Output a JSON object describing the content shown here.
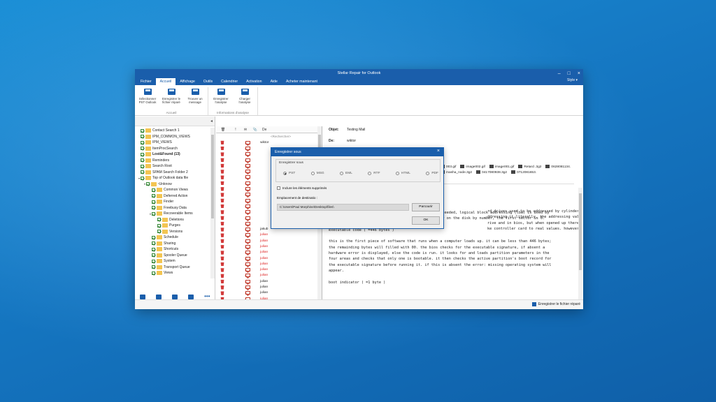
{
  "window": {
    "title": "Stellar Repair for Outlook",
    "style_label": "Style ▾"
  },
  "tabs": [
    "Fichier",
    "Accueil",
    "Affichage",
    "Outils",
    "Calendrier",
    "Activation",
    "Aide",
    "Acheter maintenant"
  ],
  "ribbon": {
    "groups": [
      {
        "label": "Accueil",
        "buttons": [
          {
            "label": "Sélectionner PST Outlook",
            "icon": "folder-icon"
          },
          {
            "label": "Enregistrer le fichier réparé",
            "icon": "save-icon"
          },
          {
            "label": "Trouver un message",
            "icon": "find-message-icon"
          }
        ]
      },
      {
        "label": "Informations d'analyse",
        "buttons": [
          {
            "label": "Enregistrer l'analyse",
            "icon": "save-analysis-icon"
          },
          {
            "label": "Charger l'analyse",
            "icon": "load-analysis-icon"
          }
        ]
      }
    ]
  },
  "tree": [
    {
      "label": "Contact Search 1",
      "indent": 1,
      "bold": false,
      "twisty": ""
    },
    {
      "label": "IPM_COMMON_VIEWS",
      "indent": 1,
      "bold": false,
      "twisty": ""
    },
    {
      "label": "IPM_VIEWS",
      "indent": 1,
      "bold": false,
      "twisty": ""
    },
    {
      "label": "ItemProcSearch",
      "indent": 1,
      "bold": false,
      "twisty": ""
    },
    {
      "label": "Lost&Found (13)",
      "indent": 1,
      "bold": true,
      "twisty": ""
    },
    {
      "label": "Reminders",
      "indent": 1,
      "bold": false,
      "twisty": ""
    },
    {
      "label": "Search Root",
      "indent": 1,
      "bold": false,
      "twisty": ""
    },
    {
      "label": "SPAM Search Folder 2",
      "indent": 1,
      "bold": false,
      "twisty": ""
    },
    {
      "label": "Top of Outlook data file",
      "indent": 1,
      "bold": false,
      "twisty": "▾"
    },
    {
      "label": "¹Unknow",
      "indent": 2,
      "bold": false,
      "twisty": "▾"
    },
    {
      "label": "Common Views",
      "indent": 3,
      "bold": false,
      "twisty": ""
    },
    {
      "label": "Deferred Action",
      "indent": 3,
      "bold": false,
      "twisty": ""
    },
    {
      "label": "Finder",
      "indent": 3,
      "bold": false,
      "twisty": ""
    },
    {
      "label": "Freebusy Data",
      "indent": 3,
      "bold": false,
      "twisty": ""
    },
    {
      "label": "Recoverable Items",
      "indent": 3,
      "bold": false,
      "twisty": "▾"
    },
    {
      "label": "Deletions",
      "indent": 4,
      "bold": false,
      "twisty": ""
    },
    {
      "label": "Purges",
      "indent": 4,
      "bold": false,
      "twisty": ""
    },
    {
      "label": "Versions",
      "indent": 4,
      "bold": false,
      "twisty": ""
    },
    {
      "label": "Schedule",
      "indent": 3,
      "bold": false,
      "twisty": ""
    },
    {
      "label": "Sharing",
      "indent": 3,
      "bold": false,
      "twisty": ""
    },
    {
      "label": "Shortcuts",
      "indent": 3,
      "bold": false,
      "twisty": ""
    },
    {
      "label": "Spooler Queue",
      "indent": 3,
      "bold": false,
      "twisty": ""
    },
    {
      "label": "System",
      "indent": 3,
      "bold": false,
      "twisty": ""
    },
    {
      "label": "Transport Queue",
      "indent": 3,
      "bold": false,
      "twisty": ""
    },
    {
      "label": "Views",
      "indent": 3,
      "bold": false,
      "twisty": ""
    }
  ],
  "nav": [
    "mail-icon",
    "calendar-icon",
    "contacts-icon",
    "tasks-icon",
    "more-icon"
  ],
  "message_list": {
    "header_de": "De",
    "search_placeholder": "<Rechercher>",
    "rows": [
      {
        "from": "wiktor",
        "dark": true
      },
      {
        "from": "",
        "dark": false
      },
      {
        "from": "",
        "dark": false
      },
      {
        "from": "",
        "dark": false
      },
      {
        "from": "",
        "dark": false
      },
      {
        "from": "",
        "dark": false
      },
      {
        "from": "",
        "dark": false
      },
      {
        "from": "",
        "dark": false
      },
      {
        "from": "",
        "dark": false
      },
      {
        "from": "",
        "dark": false
      },
      {
        "from": "",
        "dark": false
      },
      {
        "from": "",
        "dark": false
      },
      {
        "from": "",
        "dark": false
      },
      {
        "from": "",
        "dark": false
      },
      {
        "from": "",
        "dark": false
      },
      {
        "from": "jakub",
        "dark": true
      },
      {
        "from": "julian",
        "dark": false
      },
      {
        "from": "julian",
        "dark": false
      },
      {
        "from": "julian",
        "dark": false
      },
      {
        "from": "julian",
        "dark": false
      },
      {
        "from": "julian",
        "dark": false
      },
      {
        "from": "julian",
        "dark": false
      },
      {
        "from": "julian",
        "dark": false
      },
      {
        "from": "julian",
        "dark": false
      },
      {
        "from": "julian",
        "dark": true
      },
      {
        "from": "julian",
        "dark": true
      },
      {
        "from": "julian",
        "dark": true
      },
      {
        "from": "julian",
        "dark": false
      }
    ]
  },
  "reading_pane": {
    "subject_label": "Objet:",
    "subject": "Testing Mail",
    "from_label": "De:",
    "from": "wiktor",
    "attachments": [
      "003.gif",
      "image002.gif",
      "image001.gif",
      "Retard .3g2",
      "0628081134.",
      "masha_node.3g2",
      "0417080938.3g2",
      "0712081653."
    ],
    "body_top": "rd drives used to be addressed by cylinder, head and\nddressing it literally, the addressing values became\nrive and in bios, but when opened up there were only 6\nke controller card to real values. however virtual chs",
    "body": "addressing is also limited, when these values are exceeded, logical block addressing (lba) is used by\npartitions. lba is achieved by addressing each sector on the disk by number, the first sector is 0.\n\nexecutable code ( =446 bytes )\n\nthis is the first piece of software that runs when a computer loads up. it can be less than 446 bytes;\nthe remainding bytes will filled with 00. the bios checks for the executable signature, if absent a\nhardware error is displayed, else the code is run. it looks for and loads partition parameters in the\nfour areas and checks that only one is bootable. it then checks the active partition's boot record for\nthe executable signature before running it. if this is absent the error: missing operating system will\nappear.\n\nboot indicator ( =1 byte )"
  },
  "status": {
    "save_label": "Enregistrer le fichier réparé"
  },
  "dialog": {
    "title": "Enregistrer sous",
    "group_label": "Enregistrer sous",
    "formats": [
      "PST",
      "MSG",
      "EML",
      "RTF",
      "HTML",
      "PDF"
    ],
    "selected_format": "PST",
    "include_deleted_label": "Inclure les éléments supprimés",
    "destination_label": "Emplacement de destinatio :",
    "destination_value": "C:\\Users\\Paul Morphine\\Desktop\\files\\",
    "browse_label": "Parcourir",
    "ok_label": "OK"
  }
}
